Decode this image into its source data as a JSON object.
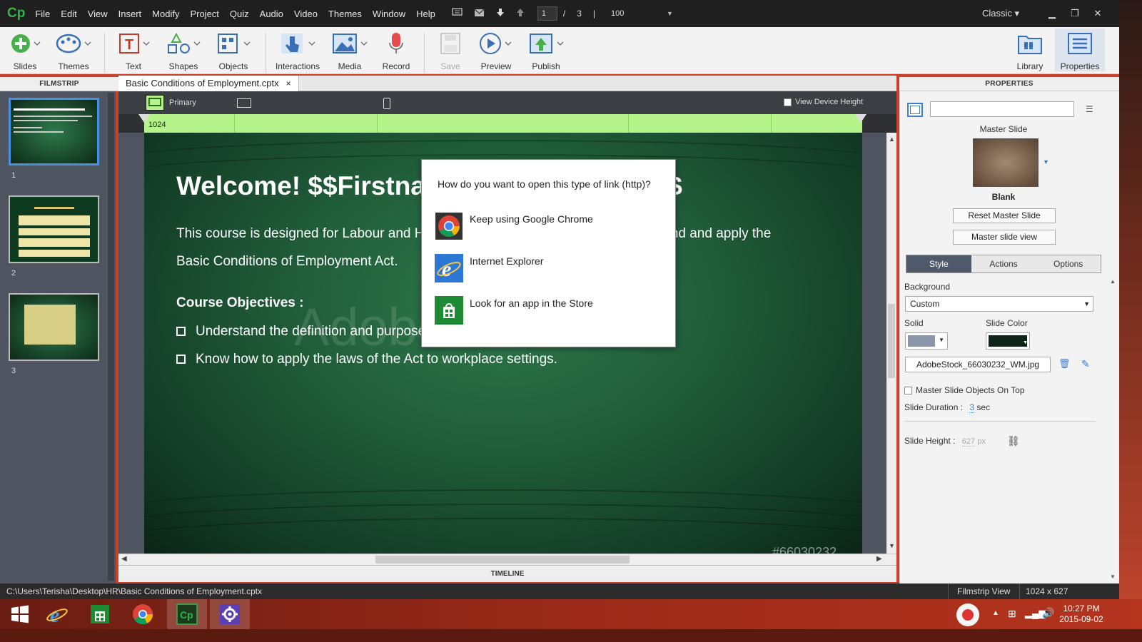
{
  "app": {
    "logo": "Cp",
    "menus": [
      "File",
      "Edit",
      "View",
      "Insert",
      "Modify",
      "Project",
      "Quiz",
      "Audio",
      "Video",
      "Themes",
      "Window",
      "Help"
    ],
    "page_current": "1",
    "page_sep": "/",
    "page_total": "3",
    "zoom": "100",
    "workspace": "Classic"
  },
  "toolbar": {
    "slides": "Slides",
    "themes": "Themes",
    "text": "Text",
    "shapes": "Shapes",
    "objects": "Objects",
    "interactions": "Interactions",
    "media": "Media",
    "record": "Record",
    "save": "Save",
    "preview": "Preview",
    "publish": "Publish",
    "library": "Library",
    "properties": "Properties"
  },
  "filmstrip": {
    "header": "FILMSTRIP",
    "slides": [
      {
        "num": "1"
      },
      {
        "num": "2"
      },
      {
        "num": "3"
      }
    ]
  },
  "document": {
    "tab_label": "Basic Conditions of Employment.cptx",
    "close": "×"
  },
  "stage": {
    "primary_label": "Primary",
    "view_device_height": "View Device Height",
    "ruler_width": "1024"
  },
  "slide": {
    "title": "Welcome! $$Firstname$$ $$Lastname$$",
    "intro_line1": "This course is designed for  Labour and Human Resource Practitioners to understand and apply  the",
    "intro_line2": "Basic Conditions of Employment Act.",
    "objectives_heading": "Course Objectives :",
    "objective1": "Understand the definition and purpose of the BCEA.",
    "objective2": "Know how to apply the laws of the Act to workplace settings.",
    "watermark": "Adobe Stock",
    "stock_id": "#66030232"
  },
  "timeline": {
    "label": "TIMELINE"
  },
  "properties": {
    "header": "PROPERTIES",
    "name_value": "",
    "master_slide_label": "Master Slide",
    "master_name": "Blank",
    "reset_btn": "Reset Master Slide",
    "master_view_btn": "Master slide view",
    "tabs": [
      "Style",
      "Actions",
      "Options"
    ],
    "background_label": "Background",
    "background_value": "Custom",
    "solid_label": "Solid",
    "slide_color_label": "Slide Color",
    "image_name": "AdobeStock_66030232_WM.jpg",
    "master_objects_on_top": "Master Slide Objects On Top",
    "slide_duration_label": "Slide Duration :",
    "slide_duration_value": "3",
    "slide_duration_unit": "sec",
    "slide_height_label": "Slide Height :",
    "slide_height_value": "627",
    "slide_height_unit": "px"
  },
  "dialog": {
    "question": "How do you want to open this type of link (http)?",
    "options": [
      {
        "label": "Keep using Google Chrome"
      },
      {
        "label": "Internet Explorer"
      },
      {
        "label": "Look for an app in the Store"
      }
    ]
  },
  "statusbar": {
    "path": "C:\\Users\\Terisha\\Desktop\\HR\\Basic Conditions of Employment.cptx",
    "view": "Filmstrip View",
    "dimensions": "1024 x 627"
  },
  "taskbar": {
    "time": "10:27 PM",
    "date": "2015-09-02"
  },
  "colors": {
    "accent": "#4a90e2",
    "ruler_green": "#b4f48a",
    "slide_bg": "#1f5a38",
    "slide_color_swatch": "#0d2418",
    "solid_swatch": "#8c96aa"
  }
}
